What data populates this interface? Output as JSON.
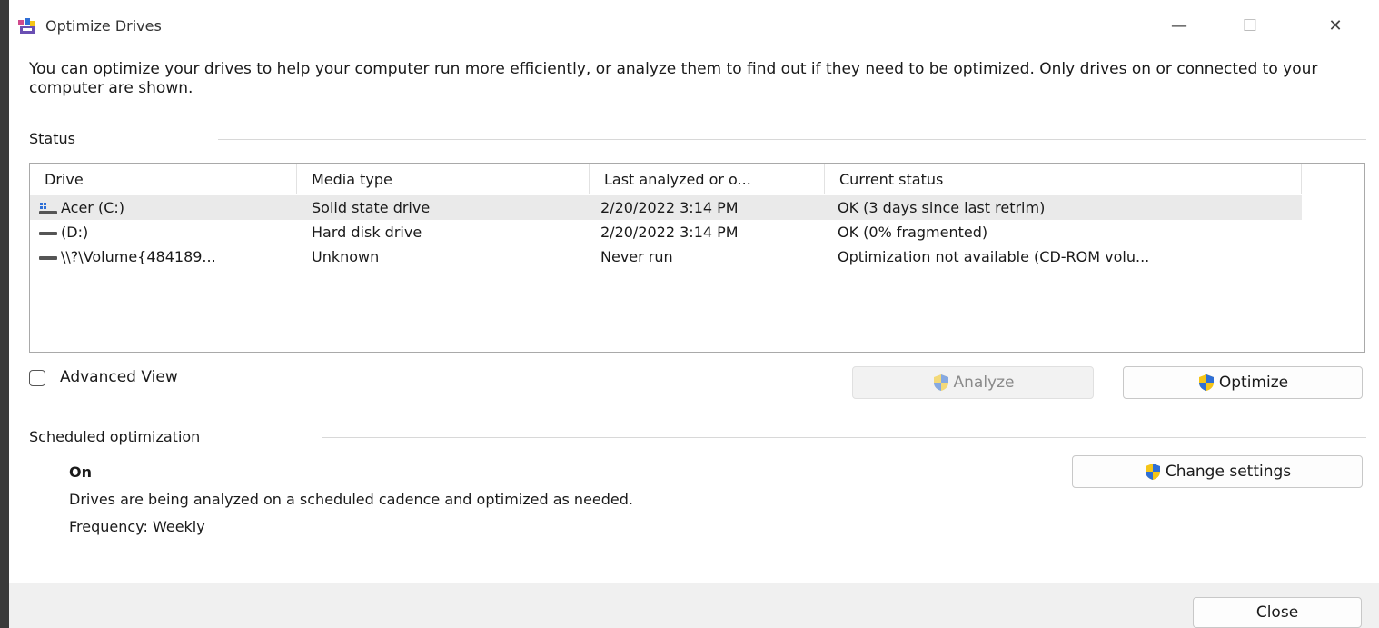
{
  "window": {
    "title": "Optimize Drives",
    "minimize_glyph": "—",
    "maximize_glyph": "☐",
    "close_glyph": "✕"
  },
  "description": "You can optimize your drives to help your computer run more efficiently, or analyze them to find out if they need to be optimized. Only drives on or connected to your computer are shown.",
  "status": {
    "label": "Status",
    "columns": [
      "Drive",
      "Media type",
      "Last analyzed or o...",
      "Current status"
    ],
    "rows": [
      {
        "drive": "Acer (C:)",
        "icon": "windows-drive-icon",
        "media": "Solid state drive",
        "last": "2/20/2022 3:14 PM",
        "status": "OK (3 days since last retrim)"
      },
      {
        "drive": "(D:)",
        "icon": "hard-disk-icon",
        "media": "Hard disk drive",
        "last": "2/20/2022 3:14 PM",
        "status": "OK (0% fragmented)"
      },
      {
        "drive": "\\\\?\\Volume{484189...",
        "icon": "hard-disk-icon",
        "media": "Unknown",
        "last": "Never run",
        "status": "Optimization not available (CD-ROM volu..."
      }
    ]
  },
  "advanced_view_label": "Advanced View",
  "buttons": {
    "analyze": "Analyze",
    "optimize": "Optimize",
    "change_settings": "Change settings",
    "close": "Close"
  },
  "scheduled": {
    "label": "Scheduled optimization",
    "state": "On",
    "description": "Drives are being analyzed on a scheduled cadence and optimized as needed.",
    "frequency": "Frequency: Weekly"
  },
  "colors": {
    "shield_blue": "#2f6fd6",
    "shield_yellow": "#f5c518",
    "selected_row": "#eaeaea"
  }
}
